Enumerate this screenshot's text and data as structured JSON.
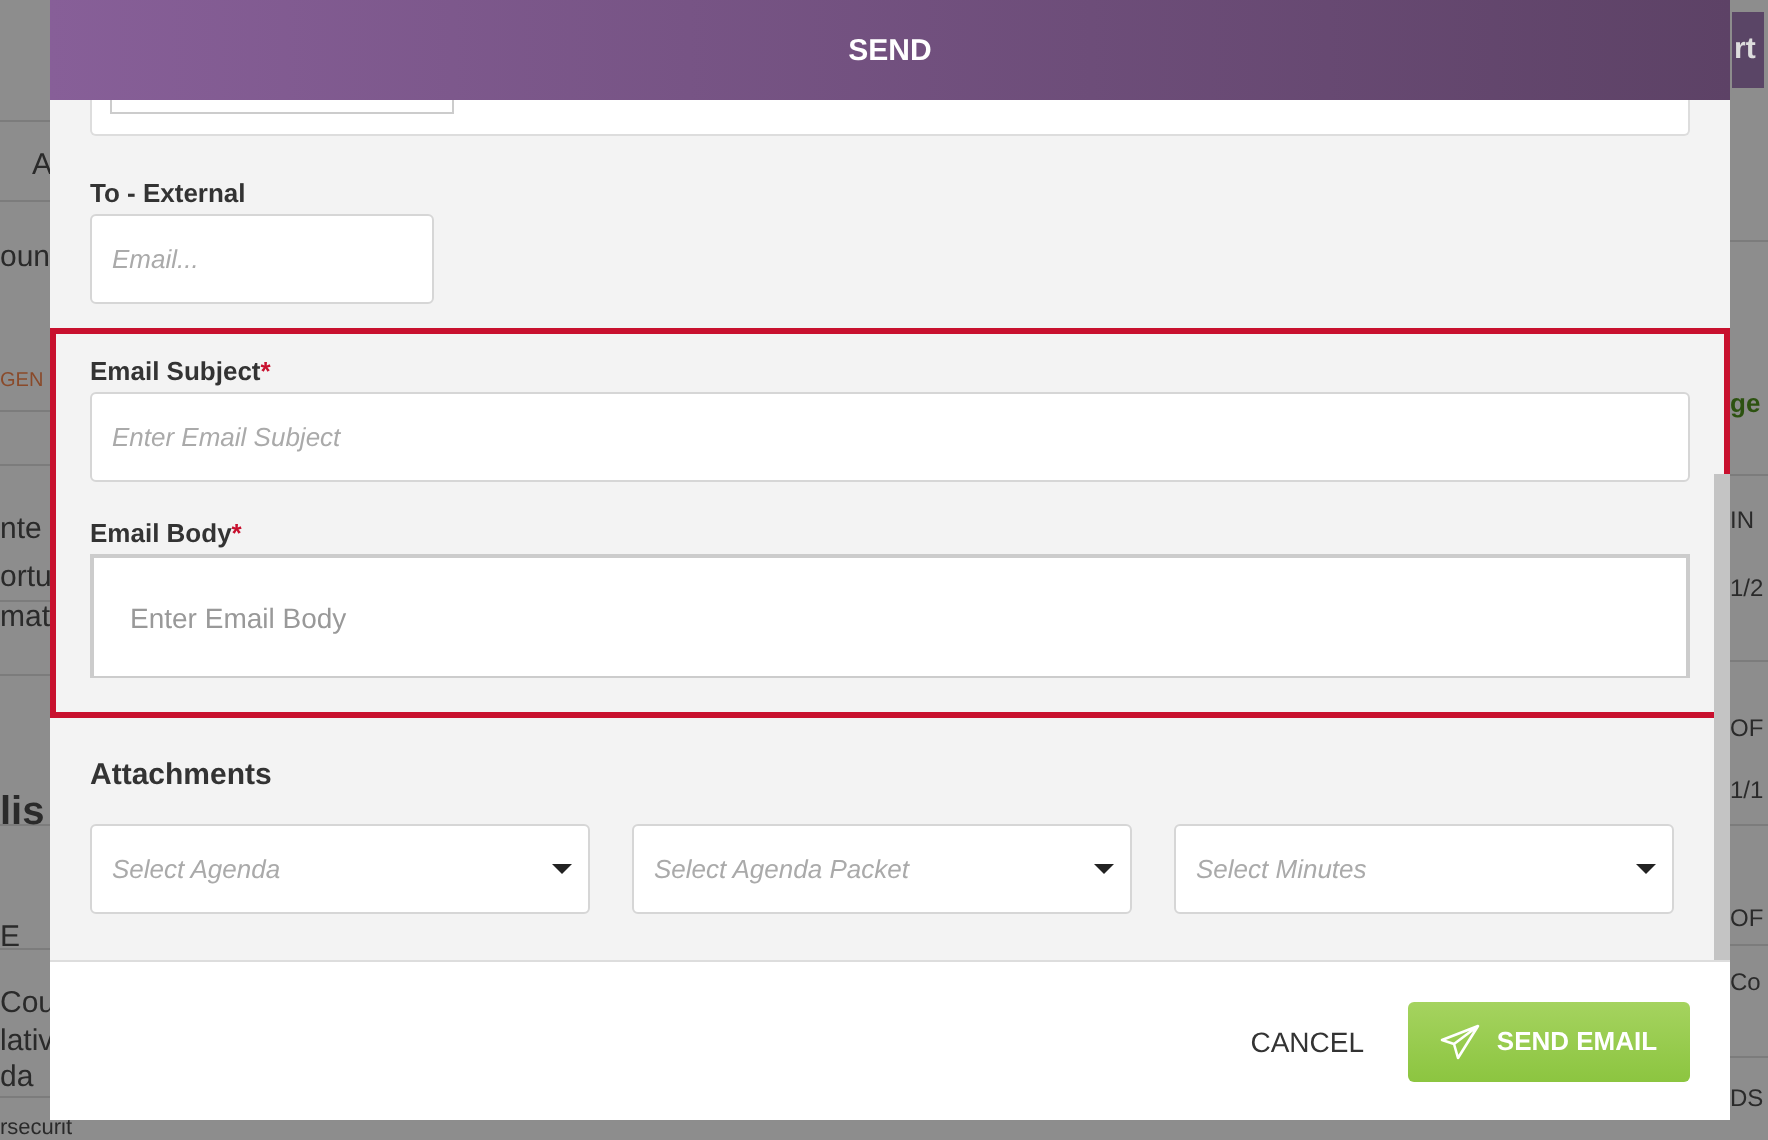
{
  "background": {
    "fragments": [
      {
        "text": "A"
      },
      {
        "text": "oun"
      },
      {
        "text": "GEN",
        "kind": "accent"
      },
      {
        "text": "nte"
      },
      {
        "text": "ortu"
      },
      {
        "text": "mat"
      },
      {
        "text": "lis",
        "kind": "heading"
      },
      {
        "text": "E"
      },
      {
        "text": "Cou"
      },
      {
        "text": "lativ"
      },
      {
        "text": "da"
      },
      {
        "text": "rsecurit",
        "kind": "small"
      },
      {
        "text": "rt",
        "kind": "button"
      },
      {
        "text": "ge",
        "kind": "link"
      },
      {
        "text": "IN",
        "kind": "edge"
      },
      {
        "text": "1/2",
        "kind": "edge"
      },
      {
        "text": "OF",
        "kind": "edge"
      },
      {
        "text": "1/1",
        "kind": "edge"
      },
      {
        "text": "OF",
        "kind": "edge"
      },
      {
        "text": "Co",
        "kind": "edge"
      },
      {
        "text": "DS",
        "kind": "edge"
      }
    ]
  },
  "modal": {
    "title": "SEND",
    "to_external": {
      "label": "To - External",
      "placeholder": "Email..."
    },
    "email_subject": {
      "label": "Email Subject",
      "required_mark": "*",
      "placeholder": "Enter Email Subject"
    },
    "email_body": {
      "label": "Email Body",
      "required_mark": "*",
      "placeholder": "Enter Email Body"
    },
    "attachments": {
      "heading": "Attachments",
      "selects": [
        {
          "placeholder": "Select Agenda"
        },
        {
          "placeholder": "Select Agenda Packet"
        },
        {
          "placeholder": "Select Minutes"
        }
      ]
    },
    "buttons": [
      {
        "kind": "text",
        "label": "CANCEL"
      },
      {
        "kind": "primary",
        "label": "SEND EMAIL"
      }
    ]
  }
}
